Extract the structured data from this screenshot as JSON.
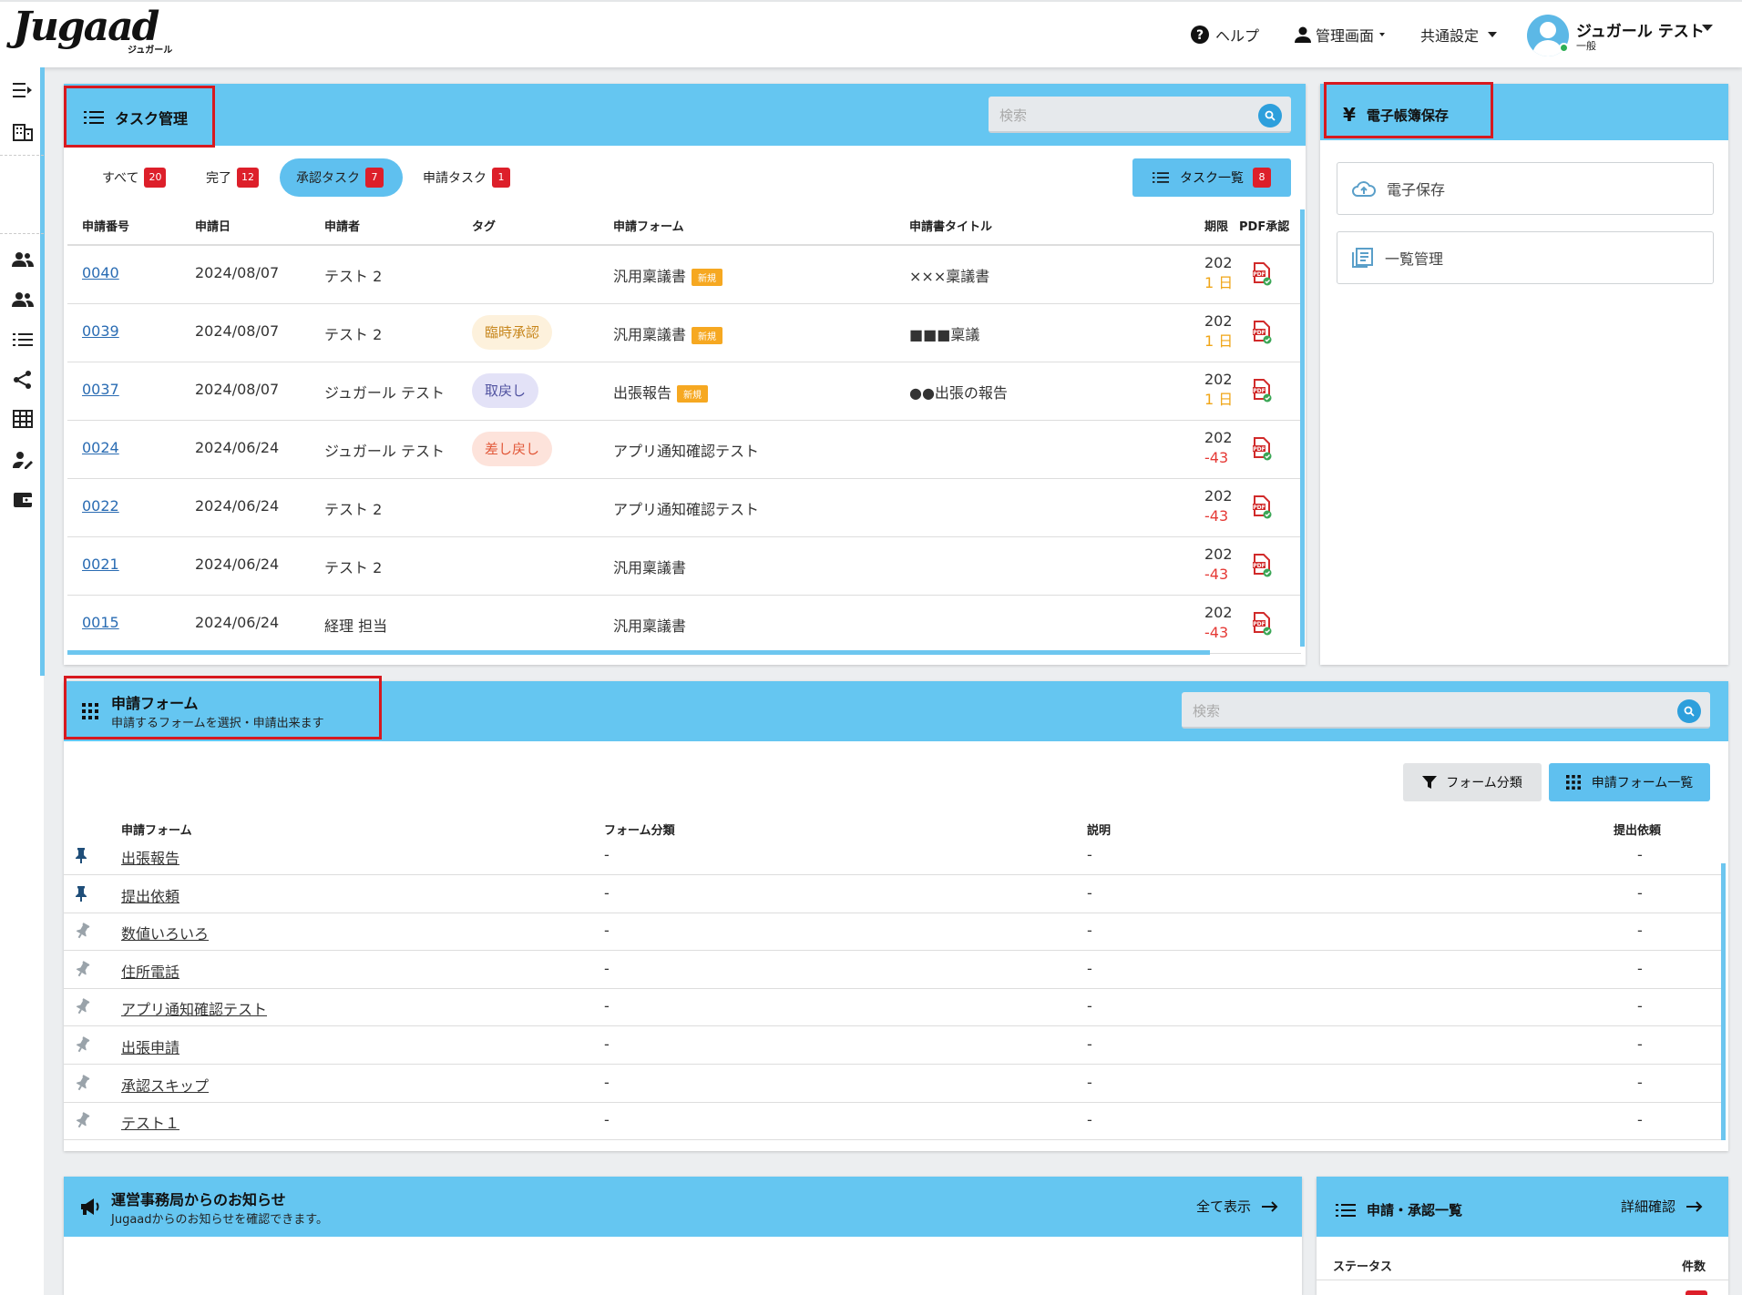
{
  "header": {
    "logo": "Jugaad",
    "logo_sub": "ジュガール",
    "help": "ヘルプ",
    "admin": "管理画面",
    "settings": "共通設定",
    "user_name": "ジュガール テスト",
    "user_role": "一般"
  },
  "tasks": {
    "title": "タスク管理",
    "search_placeholder": "検索",
    "tabs": [
      {
        "label": "すべて",
        "count": "20"
      },
      {
        "label": "完了",
        "count": "12"
      },
      {
        "label": "承認タスク",
        "count": "7"
      },
      {
        "label": "申請タスク",
        "count": "1"
      }
    ],
    "list_button": "タスク一覧",
    "list_count": "8",
    "columns": [
      "申請番号",
      "申請日",
      "申請者",
      "タグ",
      "申請フォーム",
      "申請書タイトル",
      "期限",
      "PDF承認"
    ],
    "rows": [
      {
        "no": "0040",
        "date": "2024/08/07",
        "applicant": "テスト 2",
        "tag": "",
        "form": "汎用稟議書",
        "is_new": true,
        "new_label": "新規",
        "title": "×××稟議書",
        "due_year": "202",
        "due": "1 日"
      },
      {
        "no": "0039",
        "date": "2024/08/07",
        "applicant": "テスト 2",
        "tag": "臨時承認",
        "form": "汎用稟議書",
        "is_new": true,
        "new_label": "新規",
        "title": "■■■稟議",
        "due_year": "202",
        "due": "1 日"
      },
      {
        "no": "0037",
        "date": "2024/08/07",
        "applicant": "ジュガール テスト",
        "tag": "取戻し",
        "form": "出張報告",
        "is_new": true,
        "new_label": "新規",
        "title": "●●出張の報告",
        "due_year": "202",
        "due": "1 日"
      },
      {
        "no": "0024",
        "date": "2024/06/24",
        "applicant": "ジュガール テスト",
        "tag": "差し戻し",
        "form": "アプリ通知確認テスト",
        "is_new": false,
        "new_label": "",
        "title": "",
        "due_year": "202",
        "due": "-43"
      },
      {
        "no": "0022",
        "date": "2024/06/24",
        "applicant": "テスト 2",
        "tag": "",
        "form": "アプリ通知確認テスト",
        "is_new": false,
        "new_label": "",
        "title": "",
        "due_year": "202",
        "due": "-43"
      },
      {
        "no": "0021",
        "date": "2024/06/24",
        "applicant": "テスト 2",
        "tag": "",
        "form": "汎用稟議書",
        "is_new": false,
        "new_label": "",
        "title": "",
        "due_year": "202",
        "due": "-43"
      },
      {
        "no": "0015",
        "date": "2024/06/24",
        "applicant": "経理 担当",
        "tag": "",
        "form": "汎用稟議書",
        "is_new": false,
        "new_label": "",
        "title": "",
        "due_year": "202",
        "due": "-43"
      }
    ]
  },
  "edoc": {
    "title": "電子帳簿保存",
    "items": [
      "電子保存",
      "一覧管理"
    ]
  },
  "forms": {
    "title": "申請フォーム",
    "subtitle": "申請するフォームを選択・申請出来ます",
    "search_placeholder": "検索",
    "filter_button": "フォーム分類",
    "list_button": "申請フォーム一覧",
    "columns": [
      "申請フォーム",
      "フォーム分類",
      "説明",
      "提出依頼"
    ],
    "rows": [
      {
        "name": "出張報告",
        "category": "-",
        "desc": "-",
        "request": "-",
        "pinned": true
      },
      {
        "name": "提出依頼",
        "category": "-",
        "desc": "-",
        "request": "-",
        "pinned": true
      },
      {
        "name": "数値いろいろ",
        "category": "-",
        "desc": "-",
        "request": "-",
        "pinned": false
      },
      {
        "name": "住所電話",
        "category": "-",
        "desc": "-",
        "request": "-",
        "pinned": false
      },
      {
        "name": "アプリ通知確認テスト",
        "category": "-",
        "desc": "-",
        "request": "-",
        "pinned": false
      },
      {
        "name": "出張申請",
        "category": "-",
        "desc": "-",
        "request": "-",
        "pinned": false
      },
      {
        "name": "承認スキップ",
        "category": "-",
        "desc": "-",
        "request": "-",
        "pinned": false
      },
      {
        "name": "テスト１",
        "category": "-",
        "desc": "-",
        "request": "-",
        "pinned": false
      }
    ]
  },
  "notice": {
    "title": "運営事務局からのお知らせ",
    "subtitle": "Jugaadからのお知らせを確認できます。",
    "show_all": "全て表示"
  },
  "approvals": {
    "title": "申請・承認一覧",
    "detail": "詳細確認",
    "col_status": "ステータス",
    "col_count": "件数"
  },
  "colors": {
    "accent": "#65c6f1",
    "badge": "#dd1f2a",
    "new_badge": "#f6a821",
    "link": "#2a6cb3",
    "highlight_box": "#d7191f"
  }
}
